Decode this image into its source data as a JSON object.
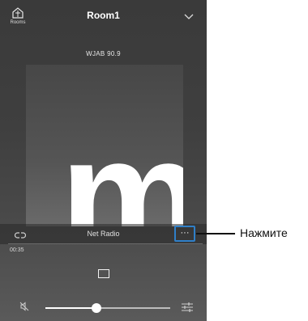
{
  "header": {
    "title": "Room1",
    "rooms_label": "Rooms"
  },
  "now_playing": {
    "station": "WJAB 90.9",
    "art_letter": "m",
    "source": "Net Radio",
    "elapsed": "00:35",
    "more_label": "···"
  },
  "volume": {
    "level": 0.41
  },
  "callout": {
    "text": "Нажмите"
  },
  "colors": {
    "highlight": "#2f7fc8"
  },
  "icons": [
    "rooms-icon",
    "chevron-down-icon",
    "link-icon",
    "stop-icon",
    "mute-icon",
    "equalizer-icon"
  ]
}
